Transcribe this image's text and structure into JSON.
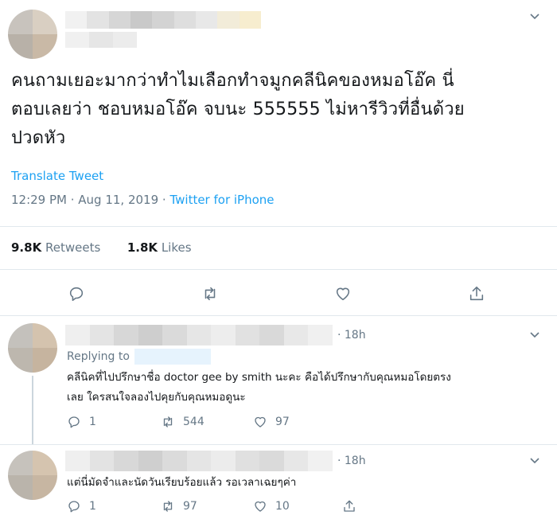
{
  "colors": {
    "link": "#1da1f2",
    "muted": "#657786",
    "text": "#14171a",
    "divider": "#e1e8ed"
  },
  "main_tweet": {
    "text_lines": [
      "คนถามเยอะมากว่าทำไมเลือกทำจมูกคลีนิคของหมอโอ๊ค นี่",
      "ตอบเลยว่า ชอบหมอโอ๊ค จบนะ 555555 ไม่หารีวิวที่อื่นด้วย",
      "ปวดหัว"
    ],
    "translate_label": "Translate Tweet",
    "timestamp": "12:29 PM · Aug 11, 2019 · ",
    "source": "Twitter for iPhone",
    "retweets_count": "9.8K",
    "retweets_label": "Retweets",
    "likes_count": "1.8K",
    "likes_label": "Likes",
    "actions": [
      "reply-icon",
      "retweet-icon",
      "like-icon",
      "share-icon"
    ]
  },
  "replies": [
    {
      "time": "· 18h",
      "replying_label": "Replying to",
      "text_lines": [
        "คลีนิคที่ไปปรึกษาชื่อ doctor gee by smith นะคะ คือได้ปรึกษากับคุณหมอโดยตรง",
        "เลย ใครสนใจลองไปคุยกับคุณหมอดูนะ"
      ],
      "reply_count": "1",
      "retweet_count": "544",
      "like_count": "97"
    },
    {
      "time": "· 18h",
      "text_lines": [
        "แต่นี่มัดจำและนัดวันเรียบร้อยแล้ว รอเวลาเฉยๆค่า"
      ],
      "reply_count": "1",
      "retweet_count": "97",
      "like_count": "10"
    }
  ]
}
